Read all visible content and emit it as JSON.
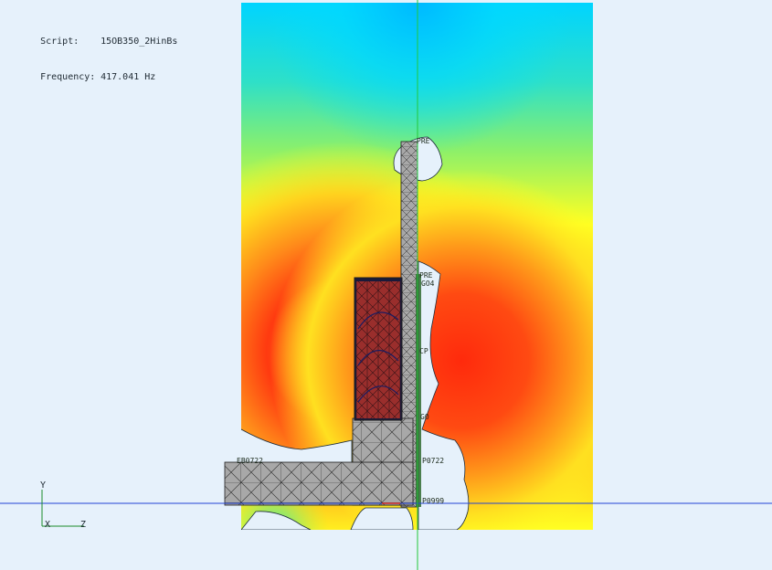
{
  "info": {
    "script_label": "Script:",
    "script_value": "15OB350_2HinBs",
    "frequency_label": "Frequency:",
    "frequency_value": "417.041 Hz"
  },
  "triad": {
    "y": "Y",
    "x": "X",
    "z": "Z"
  },
  "node_tags": [
    "PRE",
    "PRE",
    "GO4",
    "CP",
    "GO",
    "EB0722",
    "P0722",
    "P0999"
  ],
  "colors": {
    "background": "#e6f1fb",
    "field_low": "#00d4ff",
    "field_mid": "#ffff22",
    "field_high": "#ff3a10",
    "structure": "#a8a8a8",
    "mesh_line": "#1f1f1f",
    "coil": "#c0392b",
    "axis_line_h": "#2343d6",
    "axis_line_v": "#22c83a"
  }
}
